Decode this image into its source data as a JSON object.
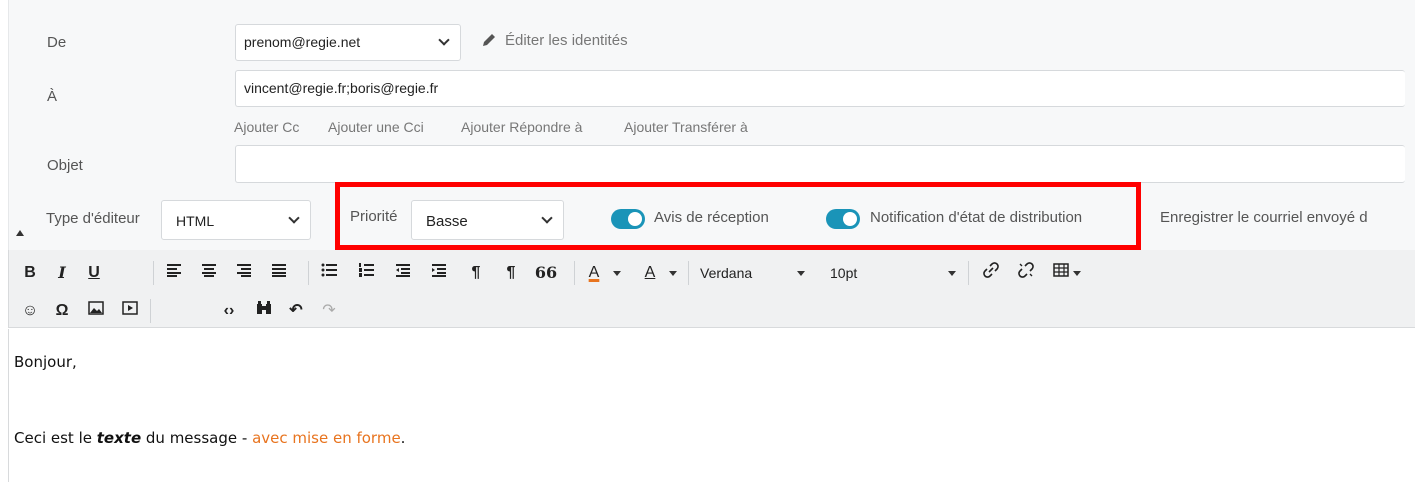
{
  "compose": {
    "from_label": "De",
    "from_value": "prenom@regie.net",
    "edit_identities": "Éditer les identités",
    "to_label": "À",
    "to_value": "vincent@regie.fr;boris@regie.fr",
    "add_cc": "Ajouter Cc",
    "add_bcc": "Ajouter une Cci",
    "add_reply_to": "Ajouter Répondre à",
    "add_forward_to": "Ajouter Transférer à",
    "subject_label": "Objet",
    "subject_value": ""
  },
  "options": {
    "editor_type_label": "Type d'éditeur",
    "editor_type_value": "HTML",
    "priority_label": "Priorité",
    "priority_value": "Basse",
    "read_receipt_label": "Avis de réception",
    "read_receipt_on": true,
    "delivery_notification_label": "Notification d'état de distribution",
    "delivery_notification_on": true,
    "save_sent_label": "Enregistrer le courriel envoyé d"
  },
  "toolbar": {
    "bold": "B",
    "italic": "I",
    "underline": "U",
    "blockquote": "66",
    "text_color": "A",
    "bg_color": "A",
    "font_family": "Verdana",
    "font_size": "10pt"
  },
  "body": {
    "greeting": "Bonjour,",
    "line_prefix": "Ceci est le ",
    "line_bold_italic": "texte",
    "line_middle": " du message - ",
    "line_colored": "avec mise en forme",
    "line_end": ".",
    "colored_text_color": "#e8741f"
  },
  "colors": {
    "toggle_on": "#1a94b8",
    "highlight_box": "#ff0000"
  }
}
